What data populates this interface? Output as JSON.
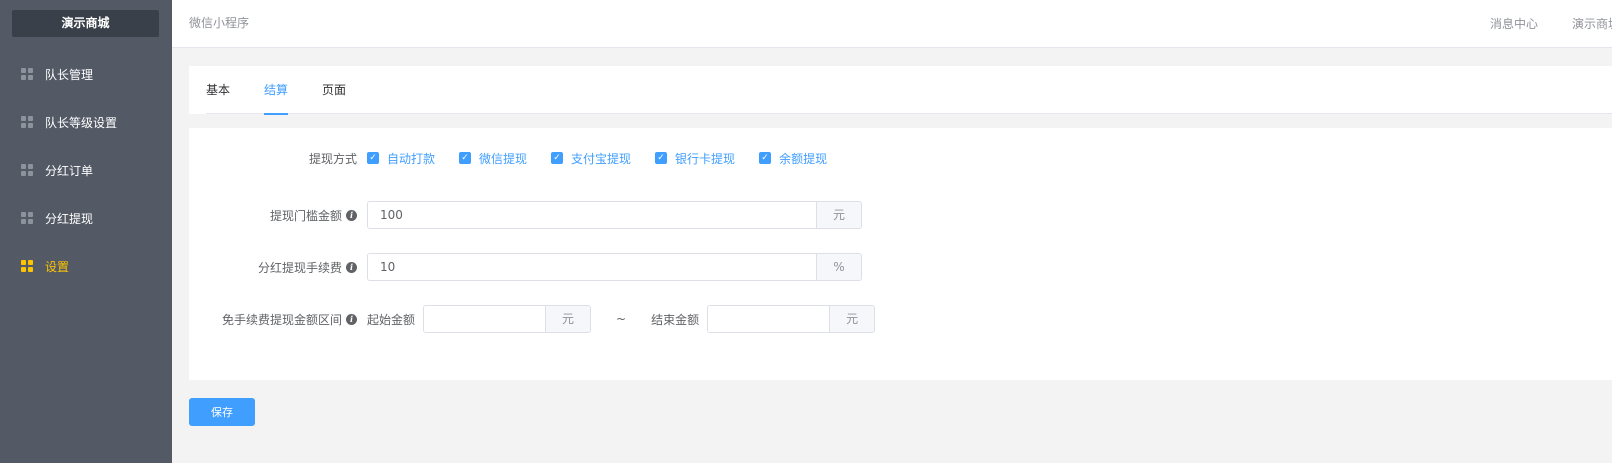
{
  "sidebar": {
    "brand": "演示商城",
    "items": [
      {
        "label": "队长管理"
      },
      {
        "label": "队长等级设置"
      },
      {
        "label": "分红订单"
      },
      {
        "label": "分红提现"
      },
      {
        "label": "设置",
        "active": true
      }
    ]
  },
  "header": {
    "title": "微信小程序",
    "links": [
      "消息中心",
      "演示商城"
    ]
  },
  "tabs": [
    {
      "label": "基本"
    },
    {
      "label": "结算",
      "active": true
    },
    {
      "label": "页面"
    }
  ],
  "form": {
    "withdraw_method": {
      "label": "提现方式",
      "options": [
        {
          "label": "自动打款",
          "checked": true
        },
        {
          "label": "微信提现",
          "checked": true
        },
        {
          "label": "支付宝提现",
          "checked": true
        },
        {
          "label": "银行卡提现",
          "checked": true
        },
        {
          "label": "余额提现",
          "checked": true
        }
      ]
    },
    "threshold": {
      "label": "提现门槛金额",
      "value": "100",
      "unit": "元"
    },
    "fee": {
      "label": "分红提现手续费",
      "value": "10",
      "unit": "%"
    },
    "fee_free_range": {
      "label": "免手续费提现金额区间",
      "start_label": "起始金额",
      "start_value": "",
      "start_unit": "元",
      "separator": "~",
      "end_label": "结束金额",
      "end_value": "",
      "end_unit": "元"
    }
  },
  "actions": {
    "save_label": "保存"
  },
  "icons": {
    "info": "info-icon",
    "nav": "grid-icon",
    "check": "check-icon"
  },
  "colors": {
    "sidebar": "#535a66",
    "brand_bg": "#3a4049",
    "accent": "#409eff",
    "active_nav": "#ffc400"
  }
}
